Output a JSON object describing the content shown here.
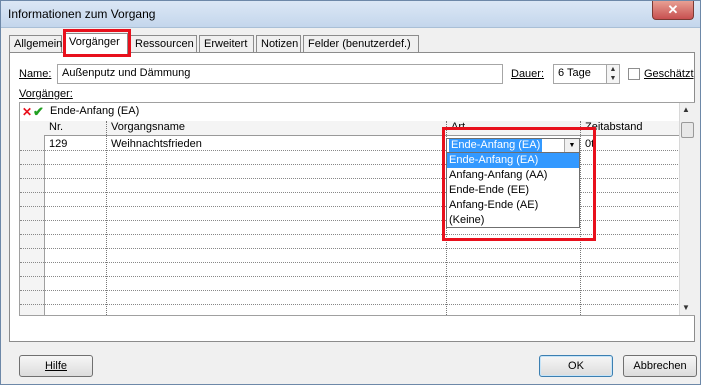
{
  "window": {
    "title": "Informationen zum Vorgang",
    "close_glyph": "✕"
  },
  "tabs": [
    {
      "label": "Allgemein"
    },
    {
      "label": "Vorgänger"
    },
    {
      "label": "Ressourcen"
    },
    {
      "label": "Erweitert"
    },
    {
      "label": "Notizen"
    },
    {
      "label": "Felder (benutzerdef.)"
    }
  ],
  "active_tab": "Vorgänger",
  "form": {
    "name_label": "Name:",
    "name_value": "Außenputz und Dämmung",
    "duration_label": "Dauer:",
    "duration_value": "6 Tage",
    "estimated_label": "Geschätzt",
    "estimated_checked": false,
    "predecessors_label": "Vorgänger:"
  },
  "grid": {
    "edit_value": "Ende-Anfang (EA)",
    "edit_icons": [
      "cancel-x-icon",
      "accept-check-icon"
    ],
    "columns": {
      "nr": "Nr.",
      "name": "Vorgangsname",
      "art": "Art",
      "lag": "Zeitabstand"
    },
    "rows": [
      {
        "nr": "129",
        "name": "Weihnachtsfrieden",
        "art": "Ende-Anfang (EA)",
        "lag": "0t"
      }
    ]
  },
  "dropdown": {
    "selected": "Ende-Anfang (EA)",
    "options": [
      "Ende-Anfang (EA)",
      "Anfang-Anfang (AA)",
      "Ende-Ende (EE)",
      "Anfang-Ende (AE)",
      "(Keine)"
    ]
  },
  "buttons": {
    "help": "Hilfe",
    "ok": "OK",
    "cancel": "Abbrechen"
  },
  "colors": {
    "highlight": "#e8101c",
    "selection": "#3399ff"
  }
}
